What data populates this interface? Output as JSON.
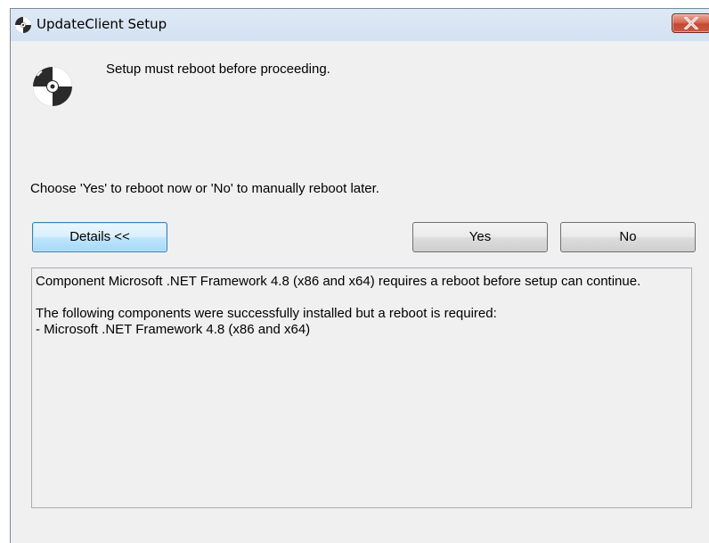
{
  "window": {
    "title": "UpdateClient Setup"
  },
  "icons": {
    "title_icon": "disc-setup-icon",
    "dialog_icon": "disc-setup-icon",
    "close_icon": "close-icon"
  },
  "colors": {
    "window_background": "#f0f0f0",
    "close_button": "#c85a42",
    "focused_button_border": "#3c7fb1"
  },
  "message": {
    "heading": "Setup must reboot before proceeding.",
    "instruction": "Choose 'Yes' to reboot now or 'No' to manually reboot later."
  },
  "buttons": {
    "details": "Details <<",
    "yes": "Yes",
    "no": "No"
  },
  "details": {
    "text": "Component Microsoft .NET Framework 4.8 (x86 and x64) requires a reboot before setup can continue.\n\nThe following components were successfully installed but a reboot is required:\n- Microsoft .NET Framework 4.8 (x86 and x64)"
  }
}
